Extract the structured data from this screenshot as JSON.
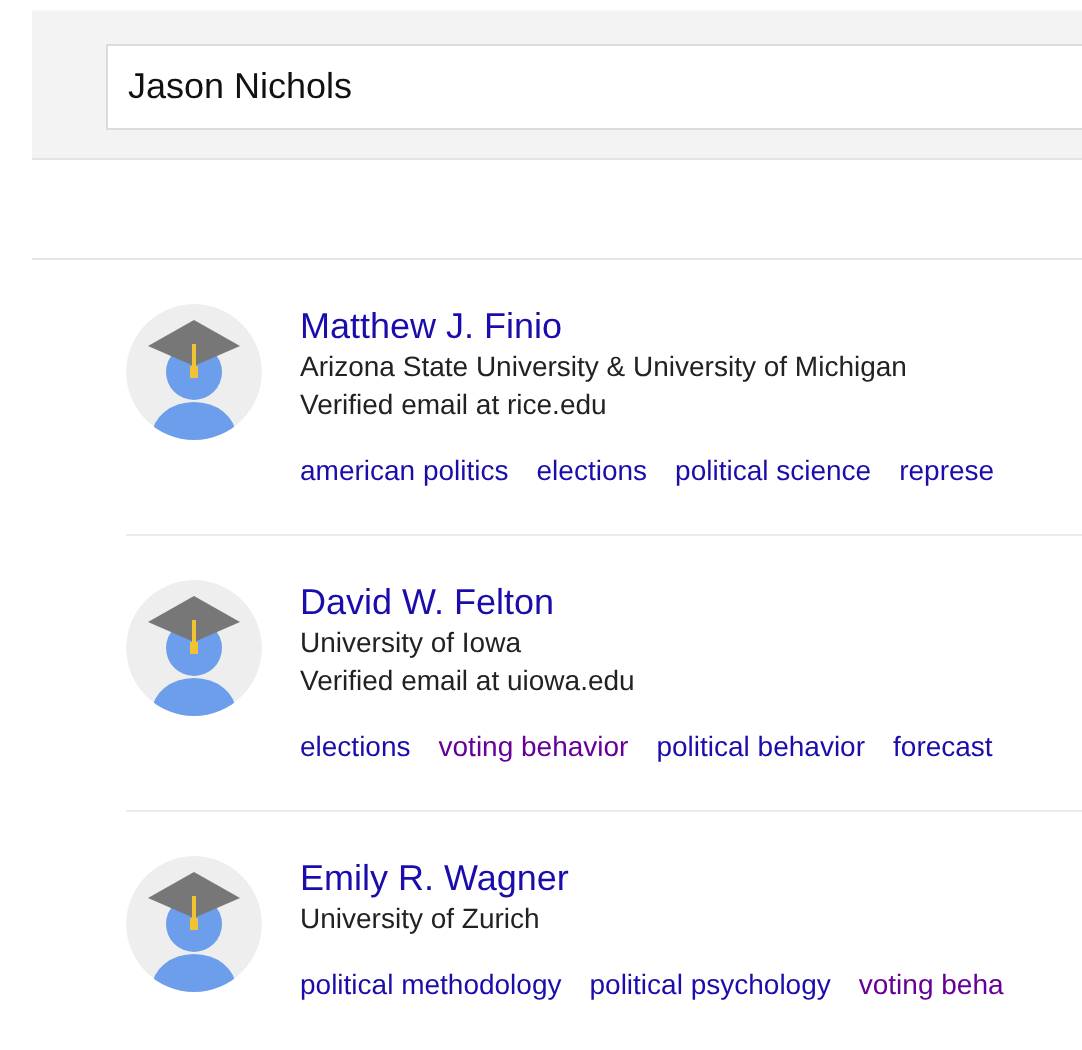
{
  "search": {
    "value": "Jason Nichols"
  },
  "results": [
    {
      "name": "Matthew J. Finio",
      "lines": [
        "Arizona State University & University of Michigan",
        "Verified email at rice.edu"
      ],
      "tags": [
        {
          "label": "american politics",
          "visited": false
        },
        {
          "label": "elections",
          "visited": false
        },
        {
          "label": "political science",
          "visited": false
        },
        {
          "label": "represe",
          "visited": false
        }
      ]
    },
    {
      "name": "David W. Felton",
      "lines": [
        "University of Iowa",
        "Verified email at uiowa.edu"
      ],
      "tags": [
        {
          "label": "elections",
          "visited": false
        },
        {
          "label": "voting behavior",
          "visited": true
        },
        {
          "label": "political behavior",
          "visited": false
        },
        {
          "label": "forecast",
          "visited": false
        }
      ]
    },
    {
      "name": "Emily R. Wagner",
      "lines": [
        "University of Zurich"
      ],
      "tags": [
        {
          "label": "political methodology",
          "visited": false
        },
        {
          "label": "political psychology",
          "visited": false
        },
        {
          "label": "voting beha",
          "visited": true
        }
      ]
    }
  ]
}
